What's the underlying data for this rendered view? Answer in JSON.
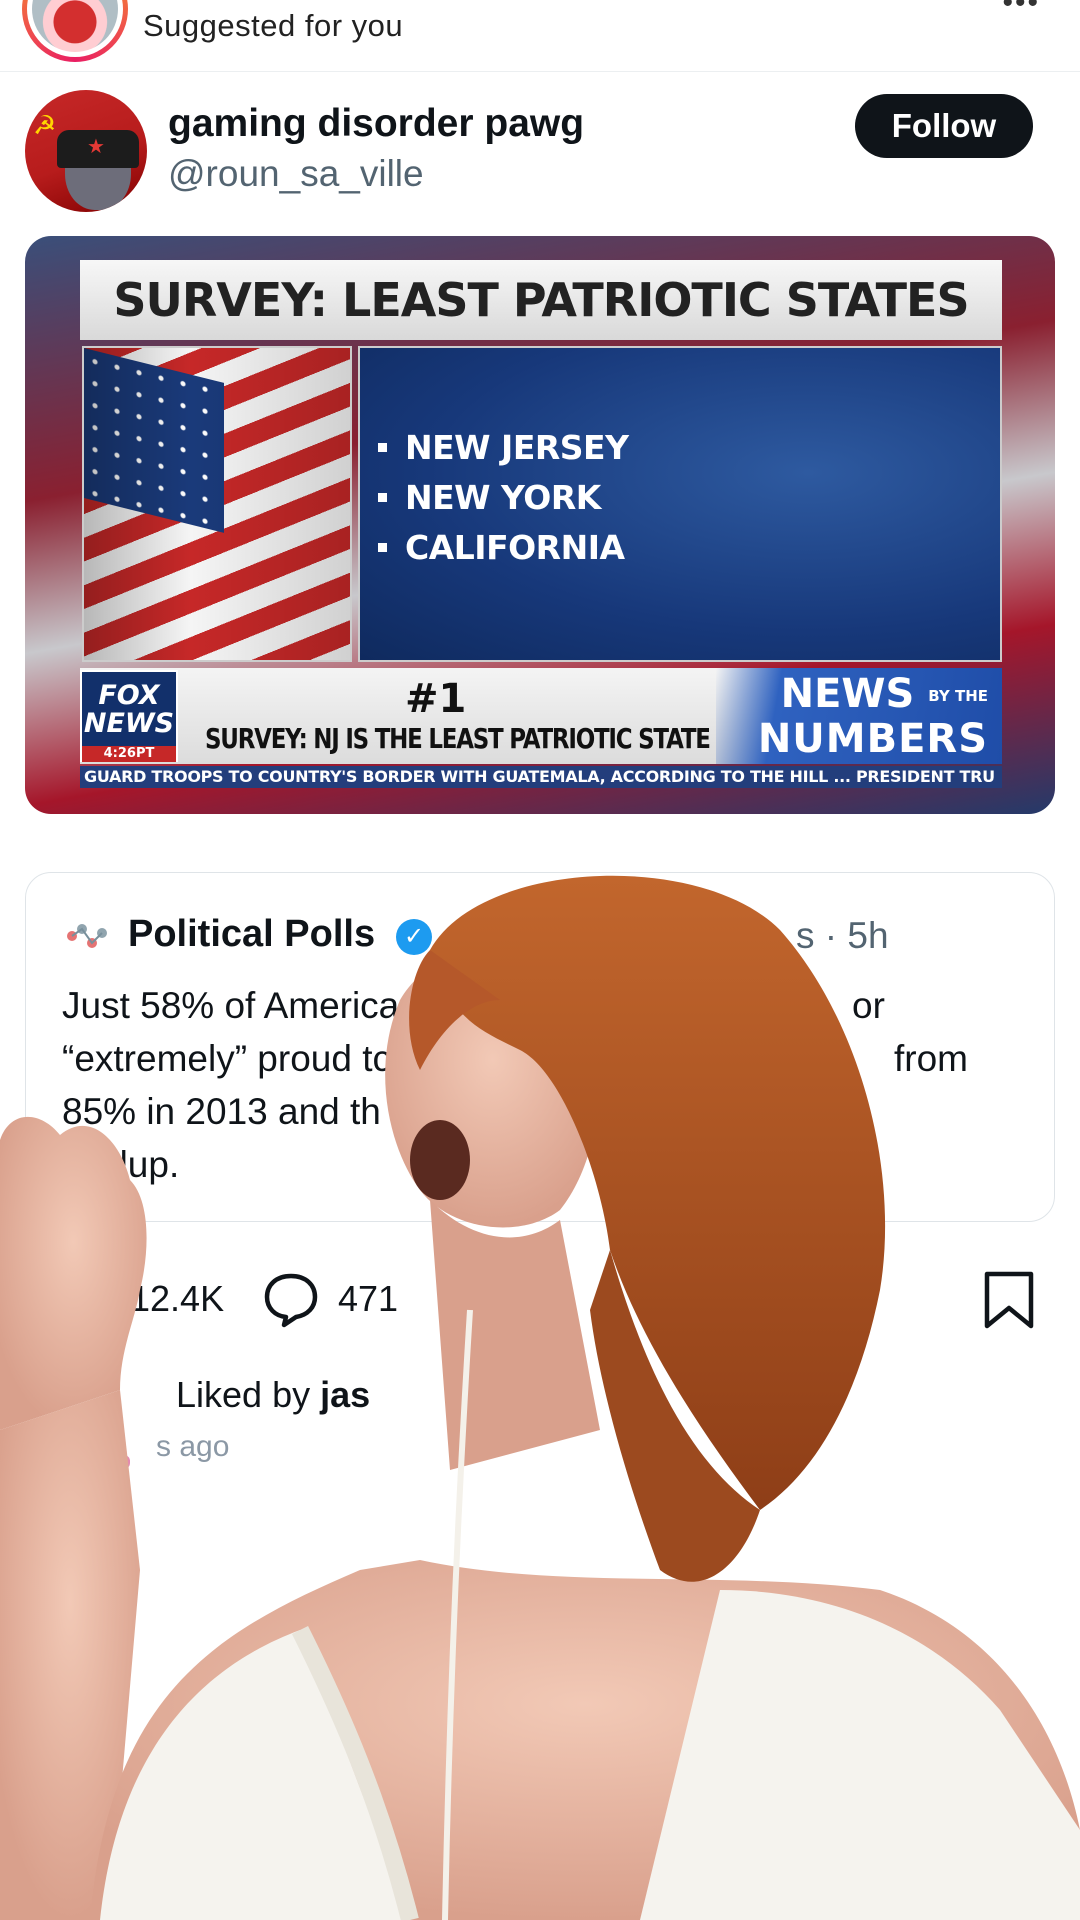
{
  "suggested": {
    "label": "Suggested for you",
    "more_icon": "more-horizontal-icon"
  },
  "account": {
    "name": "gaming disorder pawg",
    "handle": "@roun_sa_ville",
    "follow_label": "Follow"
  },
  "media": {
    "title": "SURVEY: LEAST PATRIOTIC STATES",
    "list": [
      "NEW JERSEY",
      "NEW YORK",
      "CALIFORNIA"
    ],
    "channel": "FOX NEWS",
    "channel_lines": [
      "FOX",
      "NEWS"
    ],
    "ticker_number": "#1",
    "ticker_text": "SURVEY: NJ IS THE LEAST PATRIOTIC STATE",
    "segment_top": "NEWS",
    "segment_by": "BY THE",
    "segment_bottom": "NUMBERS",
    "crawl": "GUARD TROOPS TO COUNTRY'S BORDER WITH GUATEMALA, ACCORDING TO THE HILL ...   PRESIDENT TRU"
  },
  "quote": {
    "name": "Political Polls",
    "time": "s · 5h",
    "lines": [
      "Just 58% of Americar",
      "“extremely” proud tc",
      "85% in 2013 and th",
      "Gallup."
    ],
    "lines_right": [
      "or",
      "from",
      "",
      ""
    ]
  },
  "actions": {
    "likes": "12.4K",
    "replies": "471"
  },
  "liked_by": {
    "prefix": "Liked by ",
    "name": "jas"
  },
  "time_ago": "s ago"
}
